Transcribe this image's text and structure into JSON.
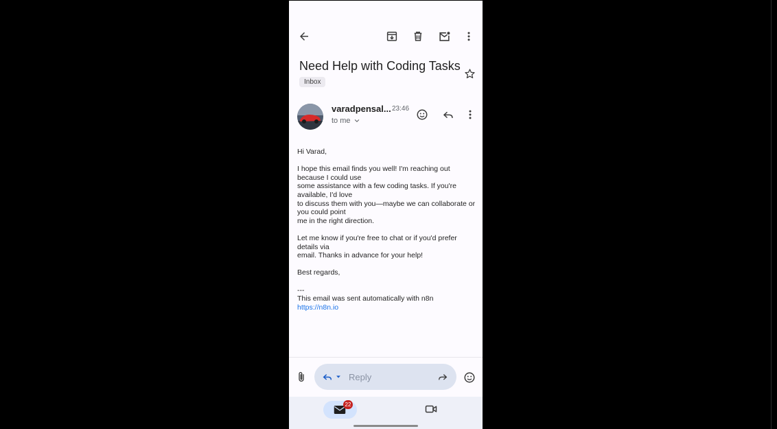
{
  "toolbar": {
    "back_icon": "arrow-back-icon",
    "archive_icon": "archive-icon",
    "delete_icon": "trash-icon",
    "mark_unread_icon": "mark-unread-icon",
    "more_icon": "more-vert-icon"
  },
  "email": {
    "subject": "Need Help with Coding Tasks",
    "label": "Inbox",
    "sender": "varadpensal...",
    "time": "23:46",
    "recipient": "to me",
    "body": {
      "greeting": "Hi Varad,",
      "para1": [
        "I hope this email finds you well! I'm reaching out because I could use",
        "some assistance with a few coding tasks. If you're available, I'd love",
        "to discuss them with you—maybe we can collaborate or you could point",
        "me in the right direction."
      ],
      "para2": [
        "Let me know if you're free to chat or if you'd prefer details via",
        "email. Thanks in advance for your help!"
      ],
      "closing": "Best regards,",
      "sig_sep": "---",
      "sig_text": "This email was sent automatically with n8n",
      "sig_link": "https://n8n.io"
    }
  },
  "reply_bar": {
    "placeholder": "Reply"
  },
  "bottom_nav": {
    "mail_badge": "22"
  },
  "colors": {
    "accent": "#1a73e8",
    "badge": "#c5221f"
  }
}
